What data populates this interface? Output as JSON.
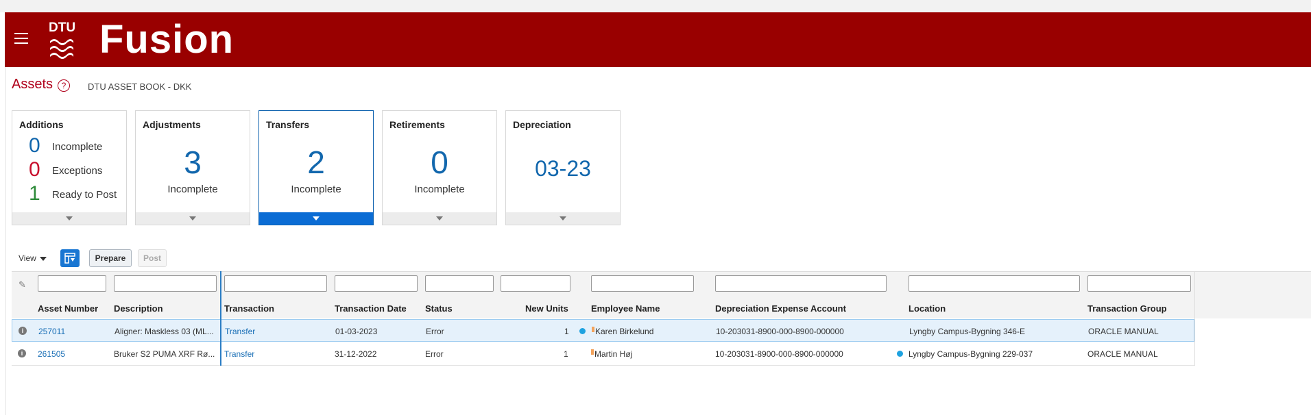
{
  "app": {
    "logo_text": "DTU",
    "title": "Fusion"
  },
  "page": {
    "title": "Assets",
    "book": "DTU ASSET BOOK - DKK"
  },
  "cards": {
    "additions": {
      "title": "Additions",
      "rows": [
        {
          "value": "0",
          "label": "Incomplete",
          "color": "#1267ad"
        },
        {
          "value": "0",
          "label": "Exceptions",
          "color": "#c8102e"
        },
        {
          "value": "1",
          "label": "Ready to Post",
          "color": "#2e8b3a"
        }
      ]
    },
    "adjustments": {
      "title": "Adjustments",
      "value": "3",
      "label": "Incomplete"
    },
    "transfers": {
      "title": "Transfers",
      "value": "2",
      "label": "Incomplete",
      "selected": true
    },
    "retirements": {
      "title": "Retirements",
      "value": "0",
      "label": "Incomplete"
    },
    "depreciation": {
      "title": "Depreciation",
      "value": "03-23"
    }
  },
  "toolbar": {
    "view_label": "View",
    "prepare_label": "Prepare",
    "post_label": "Post"
  },
  "table": {
    "columns": {
      "asset_number": "Asset Number",
      "description": "Description",
      "transaction": "Transaction",
      "transaction_date": "Transaction Date",
      "status": "Status",
      "new_units": "New Units",
      "employee_name": "Employee Name",
      "depreciation_expense_account": "Depreciation Expense Account",
      "location": "Location",
      "transaction_group": "Transaction Group"
    },
    "rows": [
      {
        "asset_number": "257011",
        "description": "Aligner: Maskless 03 (ML...",
        "transaction": "Transfer",
        "transaction_date": "01-03-2023",
        "status": "Error",
        "new_units": "1",
        "employee_name": "Karen Birkelund",
        "depreciation_expense_account": "10-203031-8900-000-8900-000000",
        "location": "Lyngby Campus-Bygning 346-E",
        "transaction_group": "ORACLE MANUAL"
      },
      {
        "asset_number": "261505",
        "description": "Bruker S2 PUMA XRF Rø...",
        "transaction": "Transfer",
        "transaction_date": "31-12-2022",
        "status": "Error",
        "new_units": "1",
        "employee_name": "Martin Høj",
        "depreciation_expense_account": "10-203031-8900-000-8900-000000",
        "location": "Lyngby Campus-Bygning 229-037",
        "transaction_group": "ORACLE MANUAL"
      }
    ]
  },
  "colors": {
    "brand": "#990000",
    "title_red": "#b0001b",
    "accent_blue": "#1267ad",
    "selected_blue": "#0b6cd4"
  }
}
